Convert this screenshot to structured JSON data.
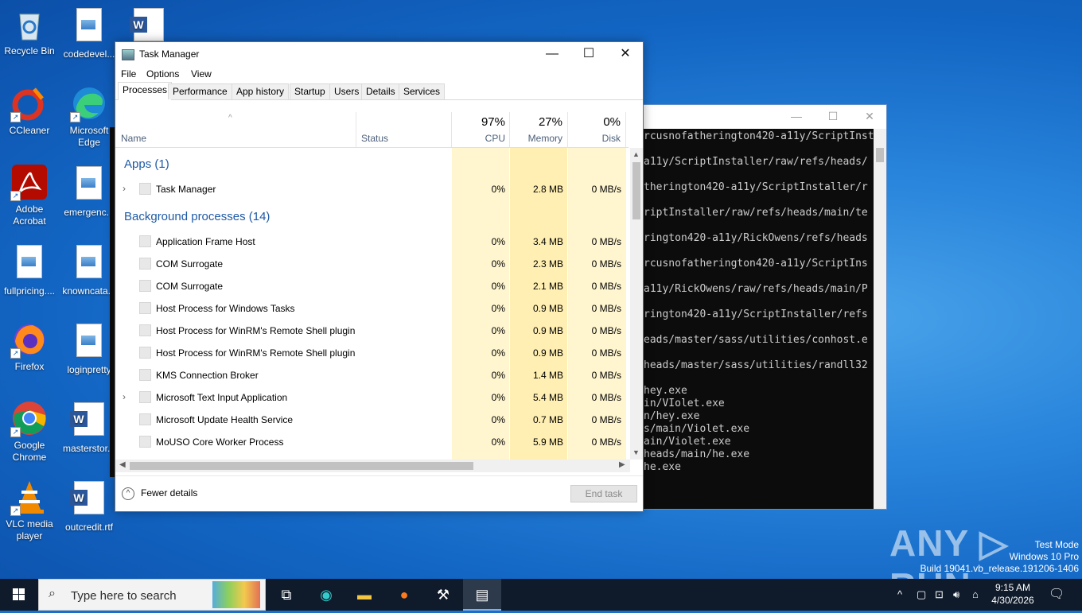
{
  "desktop": {
    "icons": [
      {
        "name": "recycle-bin",
        "label": "Recycle Bin"
      },
      {
        "name": "codedevel",
        "label": "codedevel..."
      },
      {
        "name": "word-doc-top",
        "label": ""
      },
      {
        "name": "ccleaner",
        "label": "CCleaner"
      },
      {
        "name": "microsoft-edge",
        "label": "Microsoft Edge"
      },
      {
        "name": "adobe-acrobat",
        "label": "Adobe Acrobat"
      },
      {
        "name": "emergenc",
        "label": "emergenc..."
      },
      {
        "name": "fullpricing",
        "label": "fullpricing...."
      },
      {
        "name": "knowncata",
        "label": "knowncata..."
      },
      {
        "name": "firefox",
        "label": "Firefox"
      },
      {
        "name": "loginpretty",
        "label": "loginpretty"
      },
      {
        "name": "google-chrome",
        "label": "Google Chrome"
      },
      {
        "name": "masterstor",
        "label": "masterstor..."
      },
      {
        "name": "vlc",
        "label": "VLC media player"
      },
      {
        "name": "outcredit",
        "label": "outcredit.rtf"
      }
    ]
  },
  "console": {
    "lines": [
      "rcusnofatherington420-a11y/ScriptInst",
      "",
      "a11y/ScriptInstaller/raw/refs/heads/",
      "",
      "therington420-a11y/ScriptInstaller/r",
      "",
      "riptInstaller/raw/refs/heads/main/te",
      "",
      "rington420-a11y/RickOwens/refs/heads",
      "",
      "rcusnofatherington420-a11y/ScriptIns",
      "",
      "a11y/RickOwens/raw/refs/heads/main/P",
      "",
      "rington420-a11y/ScriptInstaller/refs",
      "",
      "eads/master/sass/utilities/conhost.e",
      "",
      "heads/master/sass/utilities/randll32",
      "",
      "hey.exe",
      "in/VIolet.exe",
      "n/hey.exe",
      "s/main/Violet.exe",
      "ain/Violet.exe",
      "heads/main/he.exe",
      "he.exe"
    ]
  },
  "taskmanager": {
    "title": "Task Manager",
    "menu": [
      "File",
      "Options",
      "View"
    ],
    "tabs": [
      "Processes",
      "Performance",
      "App history",
      "Startup",
      "Users",
      "Details",
      "Services"
    ],
    "columns": {
      "name": "Name",
      "status": "Status",
      "cpu_pct": "97%",
      "cpu": "CPU",
      "mem_pct": "27%",
      "mem": "Memory",
      "disk_pct": "0%",
      "disk": "Disk"
    },
    "apps_group": "Apps (1)",
    "bg_group": "Background processes (14)",
    "apps": [
      {
        "name": "Task Manager",
        "cpu": "0%",
        "mem": "2.8 MB",
        "disk": "0 MB/s",
        "expand": true
      }
    ],
    "background": [
      {
        "name": "Application Frame Host",
        "cpu": "0%",
        "mem": "3.4 MB",
        "disk": "0 MB/s",
        "expand": false
      },
      {
        "name": "COM Surrogate",
        "cpu": "0%",
        "mem": "2.3 MB",
        "disk": "0 MB/s",
        "expand": false
      },
      {
        "name": "COM Surrogate",
        "cpu": "0%",
        "mem": "2.1 MB",
        "disk": "0 MB/s",
        "expand": false
      },
      {
        "name": "Host Process for Windows Tasks",
        "cpu": "0%",
        "mem": "0.9 MB",
        "disk": "0 MB/s",
        "expand": false
      },
      {
        "name": "Host Process for WinRM's Remote Shell plugin",
        "cpu": "0%",
        "mem": "0.9 MB",
        "disk": "0 MB/s",
        "expand": false
      },
      {
        "name": "Host Process for WinRM's Remote Shell plugin",
        "cpu": "0%",
        "mem": "0.9 MB",
        "disk": "0 MB/s",
        "expand": false
      },
      {
        "name": "KMS Connection Broker",
        "cpu": "0%",
        "mem": "1.4 MB",
        "disk": "0 MB/s",
        "expand": false
      },
      {
        "name": "Microsoft Text Input Application",
        "cpu": "0%",
        "mem": "5.4 MB",
        "disk": "0 MB/s",
        "expand": true
      },
      {
        "name": "Microsoft Update Health Service",
        "cpu": "0%",
        "mem": "0.7 MB",
        "disk": "0 MB/s",
        "expand": false
      },
      {
        "name": "MoUSO Core Worker Process",
        "cpu": "0%",
        "mem": "5.9 MB",
        "disk": "0 MB/s",
        "expand": false
      }
    ],
    "fewer_details": "Fewer details",
    "end_task": "End task"
  },
  "watermark": {
    "brand": "ANY ▷ RUN",
    "lines": [
      "Test Mode",
      "Windows 10 Pro",
      "Build 19041.vb_release.191206-1406"
    ]
  },
  "taskbar": {
    "search_placeholder": "Type here to search",
    "time": "9:15 AM",
    "date": "4/30/2026"
  },
  "colors": {
    "heat_light": "#fff4c4",
    "heat_mid": "#ffefb0",
    "group_text": "#1f5aa6"
  }
}
